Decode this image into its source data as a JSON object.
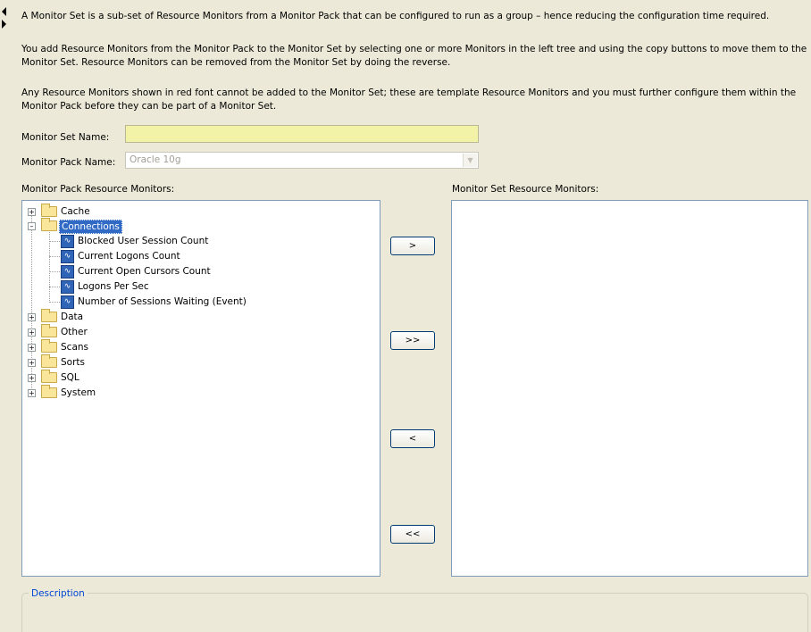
{
  "intro": {
    "p1": "A Monitor Set is a sub-set of Resource Monitors from a Monitor Pack that can be configured to run as a group – hence reducing the configuration time required.",
    "p2": "You add Resource Monitors from the Monitor Pack to the Monitor Set by selecting one or more Monitors in the left tree and using the copy buttons to move them to the Monitor Set.  Resource Monitors can be removed from the Monitor Set by doing the reverse.",
    "p3": "Any Resource Monitors shown in red font cannot be added to the Monitor Set; these are template Resource Monitors and you must further configure them within the Monitor Pack before they can be part of a Monitor Set."
  },
  "form": {
    "set_name_label": "Monitor Set Name:",
    "set_name_value": "",
    "pack_name_label": "Monitor Pack Name:",
    "pack_name_value": "Oracle 10g"
  },
  "lists": {
    "left_label": "Monitor Pack Resource Monitors:",
    "right_label": "Monitor Set Resource Monitors:"
  },
  "tree": {
    "cache": "Cache",
    "connections": "Connections",
    "children": [
      "Blocked User Session Count",
      "Current Logons Count",
      "Current Open Cursors Count",
      "Logons Per Sec",
      "Number of Sessions Waiting (Event)"
    ],
    "data": "Data",
    "other": "Other",
    "scans": "Scans",
    "sorts": "Sorts",
    "sql": "SQL",
    "system": "System"
  },
  "buttons": {
    "add": ">",
    "add_all": ">>",
    "remove": "<",
    "remove_all": "<<"
  },
  "description": {
    "legend": "Description"
  },
  "colors": {
    "background": "#ece9d8",
    "input_highlight": "#f3f3a8",
    "selection": "#316ac5",
    "legend_text": "#0046d5"
  }
}
